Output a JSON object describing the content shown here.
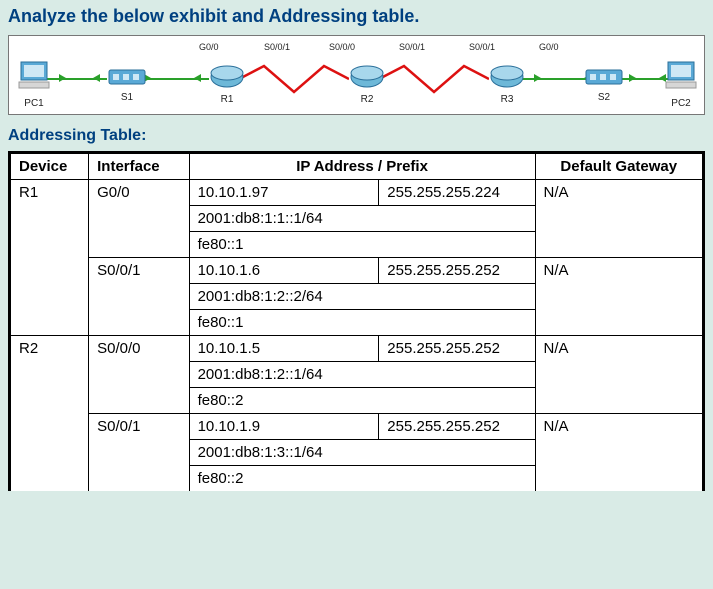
{
  "title": "Analyze the below exhibit and Addressing table.",
  "section_label": "Addressing Table:",
  "diagram": {
    "nodes": {
      "pc1": "PC1",
      "s1": "S1",
      "r1": "R1",
      "r2": "R2",
      "r3": "R3",
      "s2": "S2",
      "pc2": "PC2"
    },
    "iface_labels": {
      "r1_g00": "G0/0",
      "r1_s001": "S0/0/1",
      "r2_s000": "S0/0/0",
      "r2_s001": "S0/0/1",
      "r3_s001": "S0/0/1",
      "r3_g00": "G0/0"
    }
  },
  "table": {
    "headers": {
      "device": "Device",
      "iface": "Interface",
      "ip": "IP Address / Prefix",
      "gw": "Default Gateway"
    },
    "rows": [
      {
        "device": "R1",
        "iface": "G0/0",
        "ip": "10.10.1.97",
        "mask": "255.255.255.224",
        "gw": "N/A"
      },
      {
        "device": "",
        "iface": "",
        "ip": "2001:db8:1:1::1/64",
        "mask": "",
        "gw": ""
      },
      {
        "device": "",
        "iface": "",
        "ip": "fe80::1",
        "mask": "",
        "gw": ""
      },
      {
        "device": "",
        "iface": "S0/0/1",
        "ip": "10.10.1.6",
        "mask": "255.255.255.252",
        "gw": "N/A"
      },
      {
        "device": "",
        "iface": "",
        "ip": "2001:db8:1:2::2/64",
        "mask": "",
        "gw": ""
      },
      {
        "device": "",
        "iface": "",
        "ip": "fe80::1",
        "mask": "",
        "gw": ""
      },
      {
        "device": "R2",
        "iface": "S0/0/0",
        "ip": "10.10.1.5",
        "mask": "255.255.255.252",
        "gw": "N/A"
      },
      {
        "device": "",
        "iface": "",
        "ip": "2001:db8:1:2::1/64",
        "mask": "",
        "gw": ""
      },
      {
        "device": "",
        "iface": "",
        "ip": "fe80::2",
        "mask": "",
        "gw": ""
      },
      {
        "device": "",
        "iface": "S0/0/1",
        "ip": "10.10.1.9",
        "mask": "255.255.255.252",
        "gw": "N/A"
      },
      {
        "device": "",
        "iface": "",
        "ip": "2001:db8:1:3::1/64",
        "mask": "",
        "gw": ""
      },
      {
        "device": "",
        "iface": "",
        "ip": "fe80::2",
        "mask": "",
        "gw": ""
      }
    ]
  }
}
